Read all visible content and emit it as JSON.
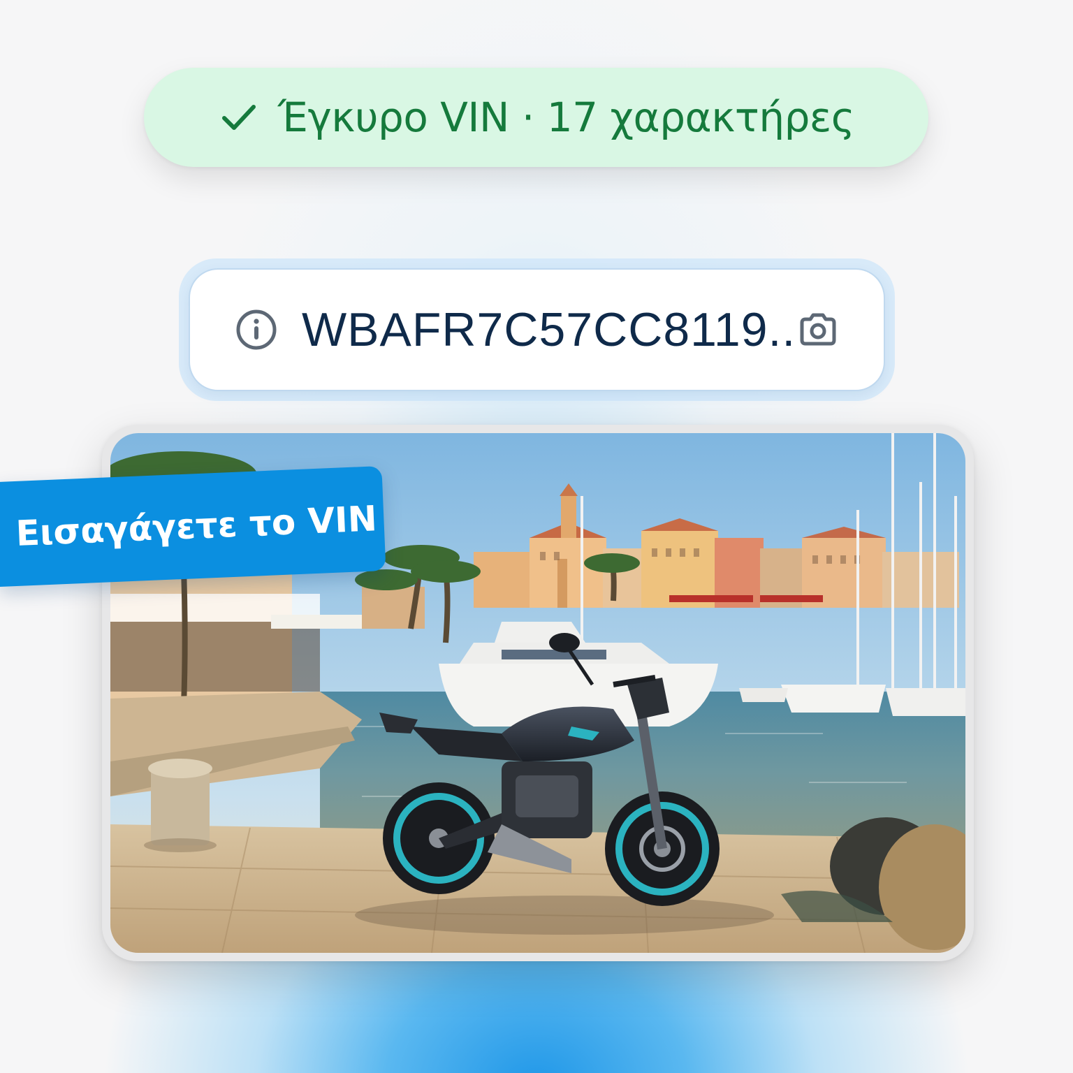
{
  "validation": {
    "text": "Έγκυρο VIN · 17 χαρακτήρες",
    "icon": "check-icon",
    "background": "#d9f7e4",
    "color": "#157a3c"
  },
  "vin_input": {
    "value": "WBAFR7C57CC8119...",
    "leading_icon": "info-icon",
    "trailing_icon": "camera-icon"
  },
  "tag": {
    "label": "Εισαγάγετε το VIN",
    "background": "#0b8fe0"
  },
  "photo": {
    "subject": "motorcycle-on-harbour-quay-photo"
  }
}
